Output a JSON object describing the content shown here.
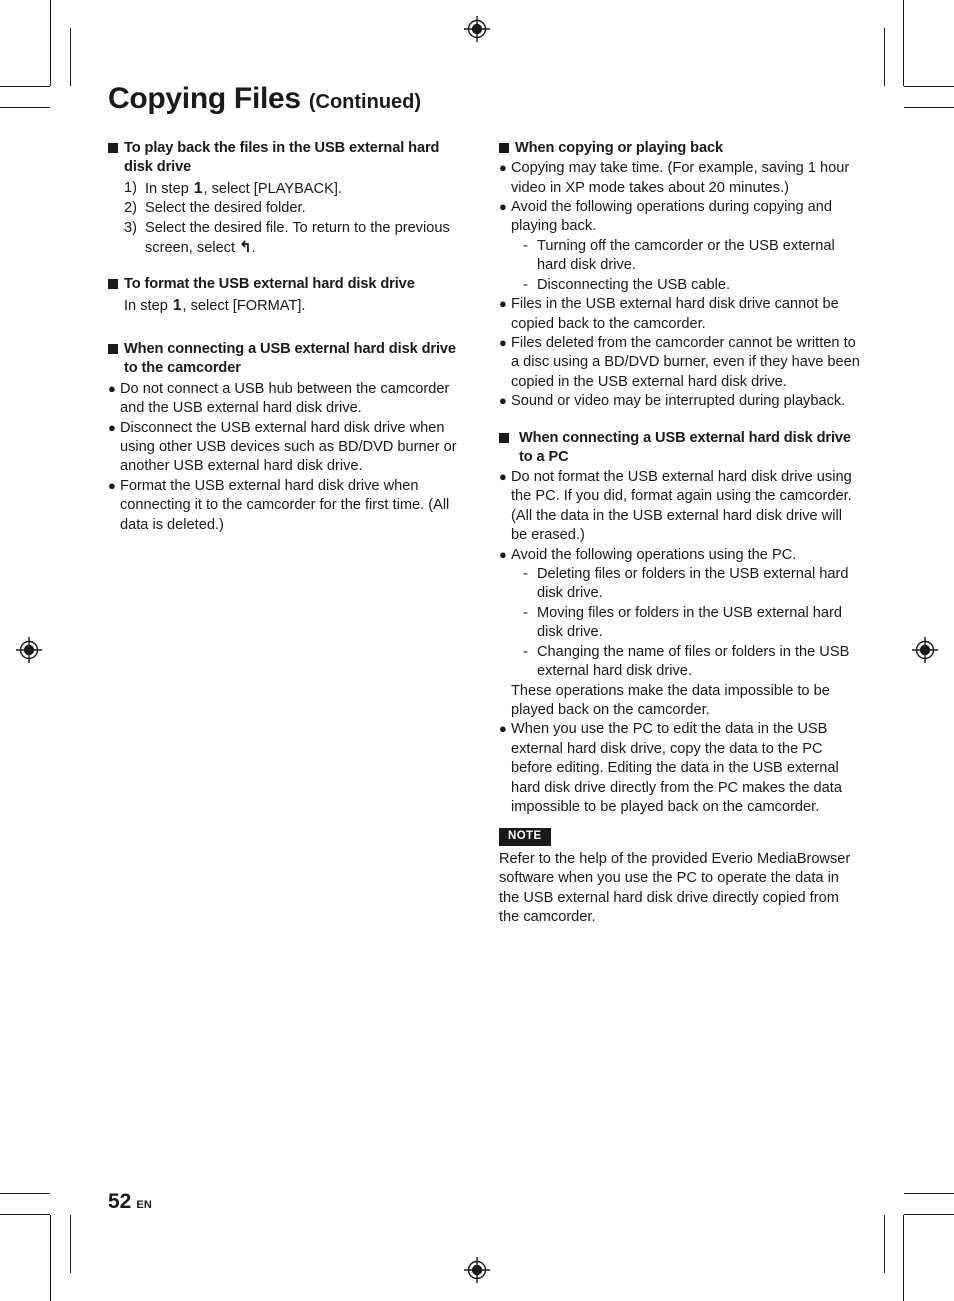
{
  "header": {
    "title": "Copying Files",
    "continued": "(Continued)"
  },
  "footer": {
    "page_number": "52",
    "language_code": "EN"
  },
  "left_column": {
    "section1": {
      "heading": "To play back the files in the USB external hard disk drive",
      "steps": [
        {
          "num": "1)",
          "pre": "In step ",
          "step": "1",
          "post": ", select [PLAYBACK]."
        },
        {
          "num": "2)",
          "pre": "Select the desired folder.",
          "step": "",
          "post": ""
        },
        {
          "num": "3)",
          "pre": "Select the desired file. To return to the previous screen, select ",
          "step": "",
          "post": "."
        }
      ],
      "return_arrow_glyph": "↰"
    },
    "section2": {
      "heading": "To format the USB external hard disk drive",
      "pre": "In step ",
      "step": "1",
      "post": ", select [FORMAT]."
    },
    "section3": {
      "heading": "When connecting a USB external hard disk drive to the camcorder",
      "bullets": [
        "Do not connect a USB hub between the camcorder and the USB external hard disk drive.",
        "Disconnect the USB external hard disk drive when using other USB devices such as BD/DVD burner or another USB external hard disk drive.",
        "Format the USB external hard disk drive when connecting it to the camcorder for the first time. (All data is deleted.)"
      ]
    }
  },
  "right_column": {
    "section1": {
      "heading": "When copying or playing back",
      "bullet1": "Copying may take time. (For example, saving 1 hour video in XP mode takes about 20 minutes.)",
      "bullet2": "Avoid the following operations during copying and playing back.",
      "sub_items": [
        "Turning off the camcorder or the USB external hard disk drive.",
        "Disconnecting the USB cable."
      ],
      "bullet3": "Files in the USB external hard disk drive cannot be copied back to the camcorder.",
      "bullet4": "Files deleted from the camcorder cannot be written to a disc using a BD/DVD burner, even if they have been copied in the USB external hard disk drive.",
      "bullet5": "Sound or video may be interrupted during playback."
    },
    "section2": {
      "heading": "When connecting a USB external hard disk drive to a PC",
      "bullet1": "Do not format the USB external hard disk drive using the PC. If you did, format again using the camcorder. (All the data in the USB external hard disk drive will be erased.)",
      "bullet2": "Avoid the following operations using the PC.",
      "sub_items": [
        "Deleting files or folders in the USB external hard disk drive.",
        "Moving files or folders in the USB external hard disk drive.",
        "Changing the name of files or folders in the USB external hard disk drive."
      ],
      "sub_closing": "These operations make the data impossible to be played back on the camcorder.",
      "bullet3": "When you use the PC to edit the data in the USB external hard disk drive, copy the data to the PC before editing. Editing the data in the USB external hard disk drive directly from the PC makes the data impossible to be played back on the camcorder."
    },
    "note": {
      "badge": "NOTE",
      "text": "Refer to the help of the provided Everio MediaBrowser software when you use the PC to operate the data in the USB external hard disk drive directly copied from the camcorder."
    }
  },
  "glyphs": {
    "bullet_dot": "●",
    "dash": "-",
    "square_bullet": "■"
  }
}
